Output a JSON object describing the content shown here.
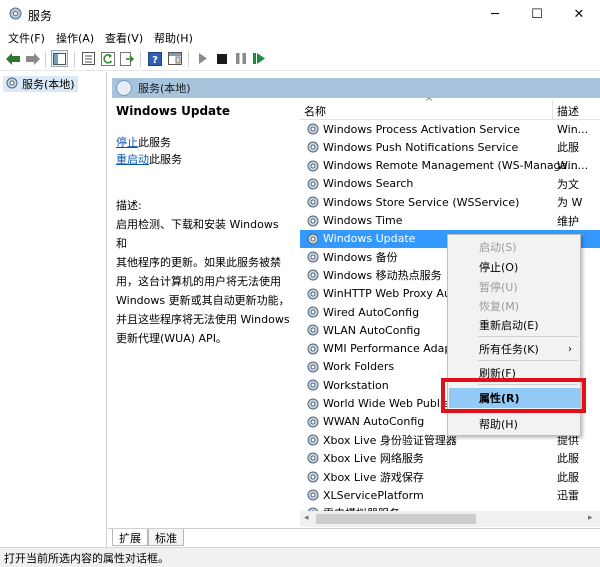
{
  "window": {
    "title": "服务",
    "controls": {
      "minimize": "─",
      "maximize": "☐",
      "close": "✕"
    }
  },
  "menu": [
    "文件(F)",
    "操作(A)",
    "查看(V)",
    "帮助(H)"
  ],
  "tree": {
    "label": "服务(本地)"
  },
  "pane": {
    "header": "服务(本地)",
    "service_title": "Windows Update",
    "stop_link": "停止",
    "stop_suffix": "此服务",
    "restart_link": "重启动",
    "restart_suffix": "此服务",
    "desc_label": "描述:",
    "desc_lines": [
      "启用检测、下载和安装 Windows 和",
      "其他程序的更新。如果此服务被禁",
      "用，这台计算机的用户将无法使用",
      "Windows 更新或其自动更新功能，",
      "并且这些程序将无法使用 Windows",
      "更新代理(WUA) API。"
    ]
  },
  "columns": {
    "name": "名称",
    "desc": "描述"
  },
  "services": [
    {
      "name": "Windows Process Activation Service",
      "desc": "Win..."
    },
    {
      "name": "Windows Push Notifications Service",
      "desc": "此服"
    },
    {
      "name": "Windows Remote Management (WS-Managa...",
      "desc": "Win..."
    },
    {
      "name": "Windows Search",
      "desc": "为文"
    },
    {
      "name": "Windows Store Service (WSService)",
      "desc": "为 W"
    },
    {
      "name": "Windows Time",
      "desc": "维护"
    },
    {
      "name": "Windows Update",
      "desc": ""
    },
    {
      "name": "Windows 备份",
      "desc": ""
    },
    {
      "name": "Windows 移动热点服务",
      "desc": ""
    },
    {
      "name": "WinHTTP Web Proxy Auto",
      "desc": ""
    },
    {
      "name": "Wired AutoConfig",
      "desc": ""
    },
    {
      "name": "WLAN AutoConfig",
      "desc": ""
    },
    {
      "name": "WMI Performance Adapte",
      "desc": ""
    },
    {
      "name": "Work Folders",
      "desc": ""
    },
    {
      "name": "Workstation",
      "desc": ""
    },
    {
      "name": "World Wide Web Publish",
      "desc": ""
    },
    {
      "name": "WWAN AutoConfig",
      "desc": ""
    },
    {
      "name": "Xbox Live 身份验证管理器",
      "desc": "提供"
    },
    {
      "name": "Xbox Live 网络服务",
      "desc": "此服"
    },
    {
      "name": "Xbox Live 游戏保存",
      "desc": "此服"
    },
    {
      "name": "XLServicePlatform",
      "desc": "迅雷"
    },
    {
      "name": "雷电模拟器服务",
      "desc": ""
    }
  ],
  "context_menu": {
    "start": "启动(S)",
    "stop": "停止(O)",
    "pause": "暂停(U)",
    "resume": "恢复(M)",
    "restart": "重新启动(E)",
    "all_tasks": "所有任务(K)",
    "refresh": "刷新(F)",
    "properties": "属性(R)",
    "help": "帮助(H)"
  },
  "tabs": {
    "extended": "扩展",
    "standard": "标准"
  },
  "status": "打开当前所选内容的属性对话框。",
  "colors": {
    "selection": "#3399ff",
    "highlight": "#91c9f7",
    "annotation": "#e0101a",
    "pane_header": "#a8c4dd"
  }
}
